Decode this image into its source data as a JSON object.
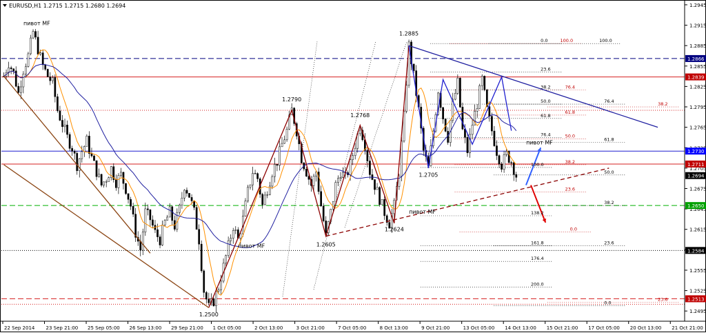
{
  "window": {
    "title": "EURUSD,H1  1.2715 1.2715 1.2680 1.2694",
    "dropdown_icon": "triangle-down-icon"
  },
  "colors": {
    "background": "#ffffff",
    "candles": "#000000",
    "ma_fast": "#ff9000",
    "ma_slow": "#1f1fa0",
    "resistance": "#d61f1f",
    "support": "#00b000",
    "neutral_level": "#000000",
    "navy_level": "#000080",
    "trendline_blue": "#1f1fa0",
    "wave_red": "#8b0000",
    "wave_blue": "#1f1fcf",
    "brown_channel": "#8b4513",
    "forecast_up": "#3060ff",
    "forecast_down": "#e00000",
    "level_label_red": "#c00000",
    "level_label_navy": "#000080",
    "level_label_green": "#00a000",
    "level_label_black": "#000000",
    "level_label_blue": "#0000ff"
  },
  "chart_data": {
    "type": "candlestick",
    "symbol": "EURUSD",
    "timeframe": "H1",
    "ohlc_header": {
      "open": 1.2715,
      "high": 1.2715,
      "low": 1.268,
      "close": 1.2694
    },
    "ylim": [
      1.248,
      1.295
    ],
    "y_ticks": [
      "1.2945",
      "1.2915",
      "1.2885",
      "1.2855",
      "1.2825",
      "1.2795",
      "1.2765",
      "1.2735",
      "1.2705",
      "1.2675",
      "1.2645",
      "1.2615",
      "1.2585",
      "1.2555",
      "1.2525",
      "1.2495"
    ],
    "x_ticks": [
      "22 Sep 2014",
      "23 Sep 21:00",
      "25 Sep 05:00",
      "26 Sep 13:00",
      "29 Sep 21:00",
      "1 Oct 05:00",
      "2 Oct 13:00",
      "3 Oct 21:00",
      "7 Oct 05:00",
      "8 Oct 13:00",
      "9 Oct 21:00",
      "13 Oct 05:00",
      "14 Oct 13:00",
      "15 Oct 21:00",
      "17 Oct 05:00",
      "20 Oct 13:00",
      "21 Oct 21:00"
    ],
    "price_path": [
      [
        0,
        1.284
      ],
      [
        1,
        1.286
      ],
      [
        2,
        1.2845
      ],
      [
        3,
        1.2815
      ],
      [
        4,
        1.285
      ],
      [
        5,
        1.287
      ],
      [
        6,
        1.2905
      ],
      [
        7,
        1.288
      ],
      [
        8,
        1.2855
      ],
      [
        9,
        1.284
      ],
      [
        10,
        1.283
      ],
      [
        11,
        1.279
      ],
      [
        12,
        1.277
      ],
      [
        13,
        1.275
      ],
      [
        14,
        1.2735
      ],
      [
        15,
        1.271
      ],
      [
        16,
        1.273
      ],
      [
        17,
        1.2745
      ],
      [
        18,
        1.272
      ],
      [
        19,
        1.27
      ],
      [
        20,
        1.268
      ],
      [
        21,
        1.269
      ],
      [
        22,
        1.2705
      ],
      [
        23,
        1.2685
      ],
      [
        24,
        1.2695
      ],
      [
        25,
        1.2675
      ],
      [
        26,
        1.265
      ],
      [
        27,
        1.261
      ],
      [
        28,
        1.2585
      ],
      [
        29,
        1.264
      ],
      [
        30,
        1.263
      ],
      [
        31,
        1.261
      ],
      [
        32,
        1.26
      ],
      [
        33,
        1.2625
      ],
      [
        34,
        1.264
      ],
      [
        35,
        1.262
      ],
      [
        36,
        1.2645
      ],
      [
        37,
        1.268
      ],
      [
        38,
        1.2665
      ],
      [
        39,
        1.264
      ],
      [
        40,
        1.26
      ],
      [
        41,
        1.2525
      ],
      [
        42,
        1.25
      ],
      [
        43,
        1.251
      ],
      [
        44,
        1.253
      ],
      [
        45,
        1.256
      ],
      [
        46,
        1.259
      ],
      [
        47,
        1.262
      ],
      [
        48,
        1.26
      ],
      [
        49,
        1.263
      ],
      [
        50,
        1.267
      ],
      [
        51,
        1.27
      ],
      [
        52,
        1.269
      ],
      [
        53,
        1.265
      ],
      [
        54,
        1.2675
      ],
      [
        55,
        1.27
      ],
      [
        56,
        1.2715
      ],
      [
        57,
        1.274
      ],
      [
        58,
        1.276
      ],
      [
        59,
        1.279
      ],
      [
        60,
        1.276
      ],
      [
        61,
        1.272
      ],
      [
        62,
        1.27
      ],
      [
        63,
        1.268
      ],
      [
        64,
        1.27
      ],
      [
        65,
        1.265
      ],
      [
        66,
        1.2605
      ],
      [
        67,
        1.264
      ],
      [
        68,
        1.268
      ],
      [
        69,
        1.27
      ],
      [
        70,
        1.269
      ],
      [
        71,
        1.271
      ],
      [
        72,
        1.274
      ],
      [
        73,
        1.2768
      ],
      [
        74,
        1.274
      ],
      [
        75,
        1.27
      ],
      [
        76,
        1.268
      ],
      [
        77,
        1.266
      ],
      [
        78,
        1.264
      ],
      [
        79,
        1.2624
      ],
      [
        80,
        1.265
      ],
      [
        81,
        1.27
      ],
      [
        82,
        1.278
      ],
      [
        83,
        1.2885
      ],
      [
        84,
        1.284
      ],
      [
        85,
        1.279
      ],
      [
        86,
        1.273
      ],
      [
        87,
        1.2705
      ],
      [
        88,
        1.276
      ],
      [
        89,
        1.282
      ],
      [
        90,
        1.278
      ],
      [
        91,
        1.275
      ],
      [
        92,
        1.28
      ],
      [
        93,
        1.283
      ],
      [
        94,
        1.276
      ],
      [
        95,
        1.273
      ],
      [
        96,
        1.277
      ],
      [
        97,
        1.28
      ],
      [
        98,
        1.2835
      ],
      [
        99,
        1.279
      ],
      [
        100,
        1.276
      ],
      [
        101,
        1.273
      ],
      [
        102,
        1.271
      ],
      [
        103,
        1.2725
      ],
      [
        104,
        1.2715
      ],
      [
        105,
        1.2694
      ]
    ],
    "horizontal_levels": [
      {
        "price": 1.2866,
        "label": "1.2866",
        "style": "dashed",
        "color": "#000080",
        "label_color": "#000080"
      },
      {
        "price": 1.2839,
        "label": "1.2839",
        "style": "solid",
        "color": "#d61f1f",
        "label_color": "#c00000"
      },
      {
        "price": 1.273,
        "label": "1.2730",
        "style": "solid",
        "color": "#1f1fcf",
        "label_color": "#0000ff"
      },
      {
        "price": 1.2711,
        "label": "1.2711",
        "style": "solid",
        "color": "#d61f1f",
        "label_color": "#c00000"
      },
      {
        "price": 1.2694,
        "label": "1.2694",
        "style": "none",
        "color": "#000000",
        "label_color": "#000000"
      },
      {
        "price": 1.265,
        "label": "1.2650",
        "style": "dashed",
        "color": "#00b000",
        "label_color": "#00a000"
      },
      {
        "price": 1.2584,
        "label": "1.2584",
        "style": "dotted",
        "color": "#000000",
        "label_color": "#000000"
      },
      {
        "price": 1.2513,
        "label": "1.2513",
        "style": "dashed",
        "color": "#d61f1f",
        "label_color": "#c00000"
      }
    ],
    "extra_level_lines": [
      {
        "price": 1.279,
        "style": "dotted",
        "color": "#d61f1f"
      },
      {
        "price": 1.2505,
        "style": "dotted",
        "color": "#d61f1f"
      }
    ],
    "annotations": [
      {
        "text": "пивот MF",
        "x_index": 6,
        "price": 1.2915
      },
      {
        "text": "1.2885",
        "x_index": 83,
        "price": 1.29
      },
      {
        "text": "1.2790",
        "x_index": 59,
        "price": 1.2803
      },
      {
        "text": "1.2768",
        "x_index": 73,
        "price": 1.278
      },
      {
        "text": "1.2705",
        "x_index": 87,
        "price": 1.2692
      },
      {
        "text": "пивот MF",
        "x_index": 109,
        "price": 1.274
      },
      {
        "text": "пивот MF",
        "x_index": 85,
        "price": 1.2638
      },
      {
        "text": "1.2624",
        "x_index": 80,
        "price": 1.2612
      },
      {
        "text": "1.2605",
        "x_index": 66,
        "price": 1.259
      },
      {
        "text": "пивот MF",
        "x_index": 50,
        "price": 1.2588
      },
      {
        "text": "1.2500",
        "x_index": 42,
        "price": 1.2487
      }
    ],
    "fib_labels": [
      {
        "text": "0.0",
        "x_index": 110,
        "price": 1.289,
        "color": "#000000"
      },
      {
        "text": "100.0",
        "x_index": 114,
        "price": 1.289,
        "color": "#c00000"
      },
      {
        "text": "100.0",
        "x_index": 122,
        "price": 1.289,
        "color": "#000000"
      },
      {
        "text": "23.6",
        "x_index": 110,
        "price": 1.2848,
        "color": "#000000"
      },
      {
        "text": "76.4",
        "x_index": 115,
        "price": 1.2822,
        "color": "#c00000"
      },
      {
        "text": "38.2",
        "x_index": 110,
        "price": 1.2822,
        "color": "#000000"
      },
      {
        "text": "76.4",
        "x_index": 123,
        "price": 1.2801,
        "color": "#000000"
      },
      {
        "text": "38.2",
        "x_index": 134,
        "price": 1.2797,
        "color": "#c00000"
      },
      {
        "text": "50.0",
        "x_index": 110,
        "price": 1.2801,
        "color": "#000000"
      },
      {
        "text": "61.8",
        "x_index": 115,
        "price": 1.2785,
        "color": "#c00000"
      },
      {
        "text": "61.8",
        "x_index": 110,
        "price": 1.278,
        "color": "#000000"
      },
      {
        "text": "76.4",
        "x_index": 110,
        "price": 1.2752,
        "color": "#000000"
      },
      {
        "text": "50.0",
        "x_index": 115,
        "price": 1.275,
        "color": "#c00000"
      },
      {
        "text": "61.8",
        "x_index": 123,
        "price": 1.2745,
        "color": "#000000"
      },
      {
        "text": "38.2",
        "x_index": 115,
        "price": 1.2712,
        "color": "#c00000"
      },
      {
        "text": "100.0",
        "x_index": 108,
        "price": 1.2708,
        "color": "#000000"
      },
      {
        "text": "50.0",
        "x_index": 123,
        "price": 1.2697,
        "color": "#000000"
      },
      {
        "text": "23.6",
        "x_index": 115,
        "price": 1.2672,
        "color": "#c00000"
      },
      {
        "text": "38.2",
        "x_index": 123,
        "price": 1.2652,
        "color": "#000000"
      },
      {
        "text": "138.2",
        "x_index": 108,
        "price": 1.2637,
        "color": "#000000"
      },
      {
        "text": "0.0",
        "x_index": 116,
        "price": 1.2613,
        "color": "#c00000"
      },
      {
        "text": "161.8",
        "x_index": 108,
        "price": 1.2593,
        "color": "#000000"
      },
      {
        "text": "23.6",
        "x_index": 123,
        "price": 1.2593,
        "color": "#000000"
      },
      {
        "text": "176.4",
        "x_index": 108,
        "price": 1.257,
        "color": "#000000"
      },
      {
        "text": "200.0",
        "x_index": 108,
        "price": 1.2532,
        "color": "#000000"
      },
      {
        "text": "23.6",
        "x_index": 134,
        "price": 1.251,
        "color": "#c00000"
      },
      {
        "text": "0.0",
        "x_index": 123,
        "price": 1.2505,
        "color": "#000000"
      }
    ],
    "wave_lines": [
      {
        "color": "#8b0000",
        "points": [
          [
            42,
            1.25
          ],
          [
            59,
            1.279
          ],
          [
            66,
            1.2605
          ],
          [
            73,
            1.2768
          ],
          [
            80,
            1.2624
          ],
          [
            83,
            1.2885
          ]
        ]
      },
      {
        "color": "#1f1fcf",
        "points": [
          [
            83,
            1.2885
          ],
          [
            87,
            1.2705
          ],
          [
            90,
            1.2835
          ],
          [
            96,
            1.274
          ],
          [
            102,
            1.2839
          ],
          [
            104,
            1.276
          ]
        ]
      },
      {
        "color": "#1f1fa0",
        "points": [
          [
            83,
            1.2885
          ],
          [
            134,
            1.2765
          ]
        ]
      },
      {
        "color": "#8b0000",
        "style": "dashed",
        "points": [
          [
            66,
            1.2605
          ],
          [
            124,
            1.2705
          ]
        ]
      },
      {
        "color": "#8b4513",
        "points": [
          [
            0,
            1.284
          ],
          [
            30,
            1.258
          ]
        ]
      },
      {
        "color": "#8b4513",
        "points": [
          [
            0,
            1.271
          ],
          [
            42,
            1.25
          ]
        ]
      }
    ],
    "forecast_arrows": [
      {
        "color": "#3060ff",
        "from": [
          107,
          1.268
        ],
        "to": [
          110,
          1.2735
        ]
      },
      {
        "color": "#e00000",
        "from": [
          108,
          1.268
        ],
        "to": [
          111,
          1.2625
        ]
      }
    ]
  }
}
